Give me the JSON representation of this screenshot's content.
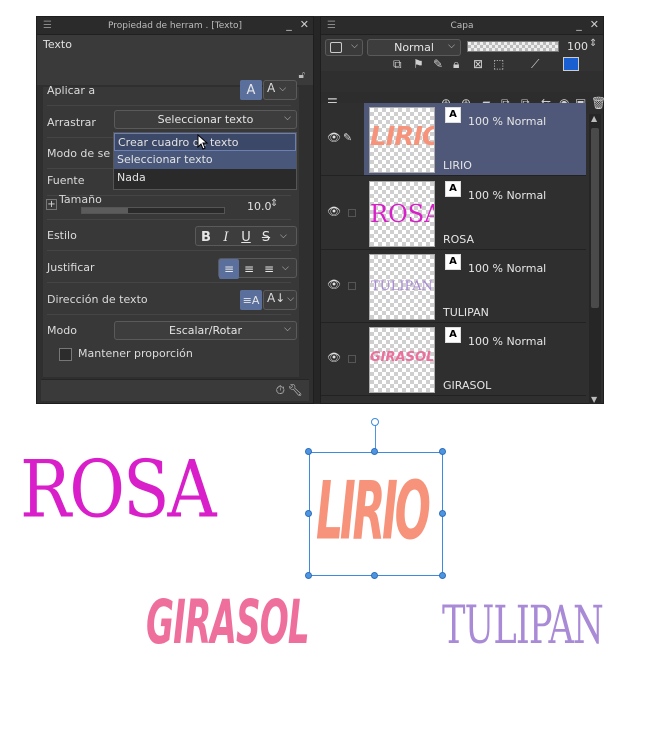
{
  "tool_panel": {
    "title": "Propiedad de herram . [Texto]",
    "header_label": "Texto",
    "rows": {
      "apply_to": "Aplicar a",
      "drag": "Arrastrar",
      "drag_value": "Seleccionar texto",
      "text_mode": "Modo de se",
      "font": "Fuente",
      "size": "Tamaño",
      "size_value": "10.0",
      "style": "Estilo",
      "justify": "Justificar",
      "direction": "Dirección de texto",
      "mode": "Modo",
      "mode_value": "Escalar/Rotar",
      "keep_ratio": "Mantener proporción"
    },
    "dropdown_options": [
      "Crear cuadro de texto",
      "Seleccionar texto",
      "Nada"
    ],
    "style_buttons": [
      "B",
      "I",
      "U",
      "S"
    ]
  },
  "layer_panel": {
    "title": "Capa",
    "blend_mode": "Normal",
    "opacity": "100",
    "layers": [
      {
        "name": "LIRIO",
        "blend": "100 % Normal",
        "thumb_text": "LIRIO",
        "color": "#f6937a",
        "selected": true
      },
      {
        "name": "ROSA",
        "blend": "100 % Normal",
        "thumb_text": "ROSA",
        "color": "#d81fc9",
        "selected": false
      },
      {
        "name": "TULIPAN",
        "blend": "100 % Normal",
        "thumb_text": "TULIPAN",
        "color": "#a98ad6",
        "selected": false
      },
      {
        "name": "GIRASOL",
        "blend": "100 % Normal",
        "thumb_text": "GIRASOL",
        "color": "#ee6f9c",
        "selected": false
      }
    ]
  },
  "canvas": {
    "words": [
      {
        "text": "ROSA",
        "color": "#d81fc9"
      },
      {
        "text": "LIRIO",
        "color": "#f6937a"
      },
      {
        "text": "GIRASOL",
        "color": "#ee6f9c"
      },
      {
        "text": "TULIPAN",
        "color": "#a98ad6"
      }
    ]
  }
}
